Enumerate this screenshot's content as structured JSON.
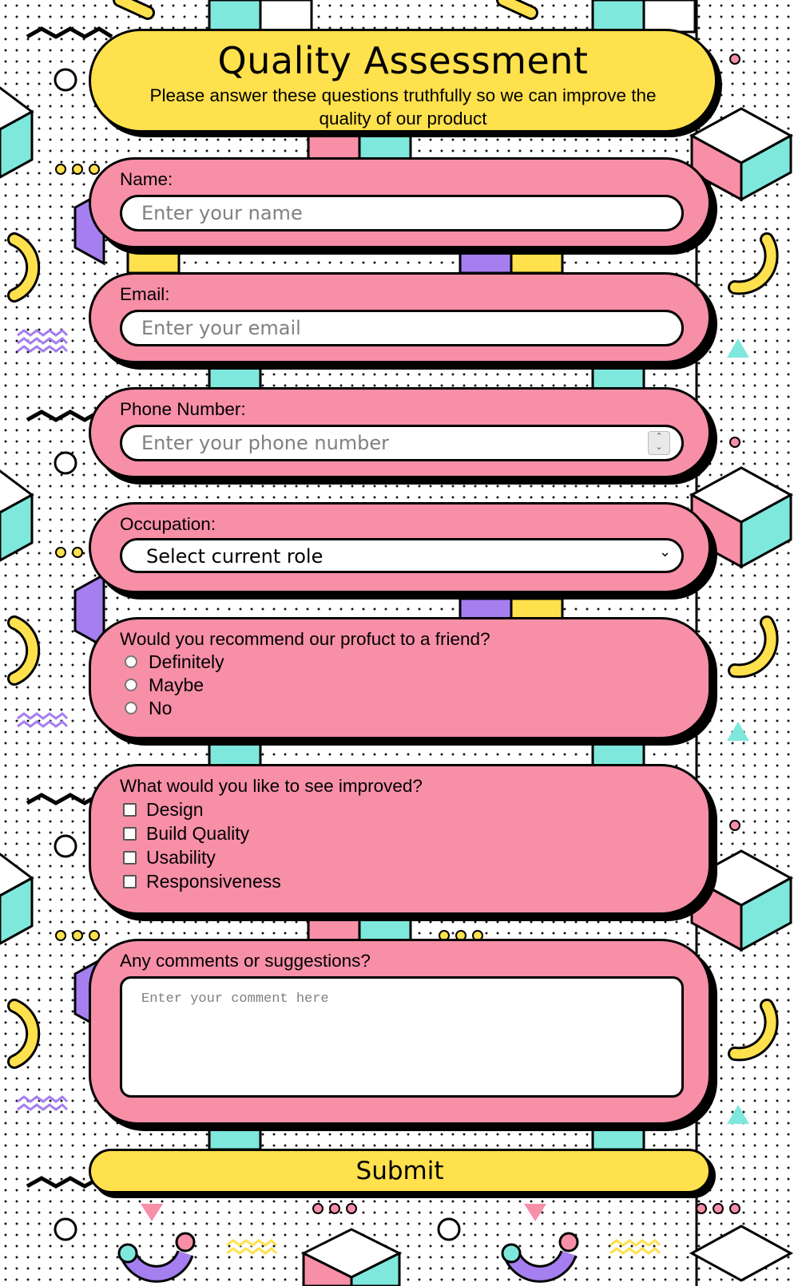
{
  "header": {
    "title": "Quality Assessment",
    "subtitle": "Please answer these questions truthfully so we can improve the quality of our product"
  },
  "name": {
    "label": "Name:",
    "placeholder": "Enter your name"
  },
  "email": {
    "label": "Email:",
    "placeholder": "Enter your email"
  },
  "phone": {
    "label": "Phone Number:",
    "placeholder": "Enter your phone number"
  },
  "occupation": {
    "label": "Occupation:",
    "selected": "Select current role"
  },
  "recommend": {
    "question": "Would you recommend our profuct to a friend?",
    "options": [
      "Definitely",
      "Maybe",
      "No"
    ]
  },
  "improve": {
    "question": "What would you like to see improved?",
    "options": [
      "Design",
      "Build Quality",
      "Usability",
      "Responsiveness"
    ]
  },
  "comments": {
    "label": "Any comments or suggestions?",
    "placeholder": "Enter your comment here"
  },
  "submit_label": "Submit",
  "colors": {
    "card": "#f78fa7",
    "header": "#ffe14d",
    "accent_teal": "#7fe8dc",
    "accent_purple": "#a57ff0",
    "accent_yellow": "#ffe14d"
  }
}
